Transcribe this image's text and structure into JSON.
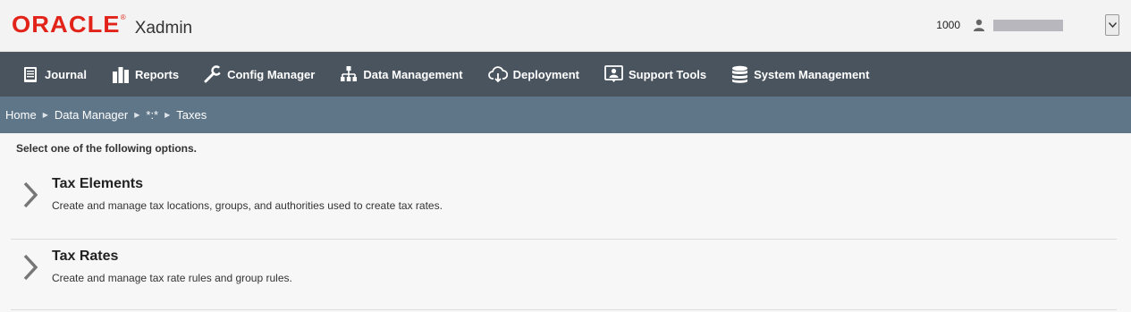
{
  "header": {
    "brand": "ORACLE",
    "reg_mark": "®",
    "app_name": "Xadmin",
    "org_id": "1000",
    "icons": {
      "user": "user-icon",
      "dropdown": "chevron-down-icon"
    }
  },
  "nav": {
    "items": [
      {
        "label": "Journal",
        "icon": "journal-icon"
      },
      {
        "label": "Reports",
        "icon": "bar-chart-icon"
      },
      {
        "label": "Config Manager",
        "icon": "wrench-icon"
      },
      {
        "label": "Data Management",
        "icon": "hierarchy-icon"
      },
      {
        "label": "Deployment",
        "icon": "cloud-download-icon"
      },
      {
        "label": "Support Tools",
        "icon": "support-icon"
      },
      {
        "label": "System Management",
        "icon": "database-icon"
      }
    ]
  },
  "breadcrumb": {
    "items": [
      "Home",
      "Data Manager",
      "*:*",
      "Taxes"
    ]
  },
  "content": {
    "prompt": "Select one of the following options.",
    "options": [
      {
        "title": "Tax Elements",
        "description": "Create and manage tax locations, groups, and authorities used to create tax rates."
      },
      {
        "title": "Tax Rates",
        "description": "Create and manage tax rate rules and group rules."
      }
    ]
  },
  "colors": {
    "brand_red": "#e2231a",
    "nav_bg": "#49545e",
    "breadcrumb_bg": "#5f7689",
    "page_bg": "#f7f7f7"
  }
}
